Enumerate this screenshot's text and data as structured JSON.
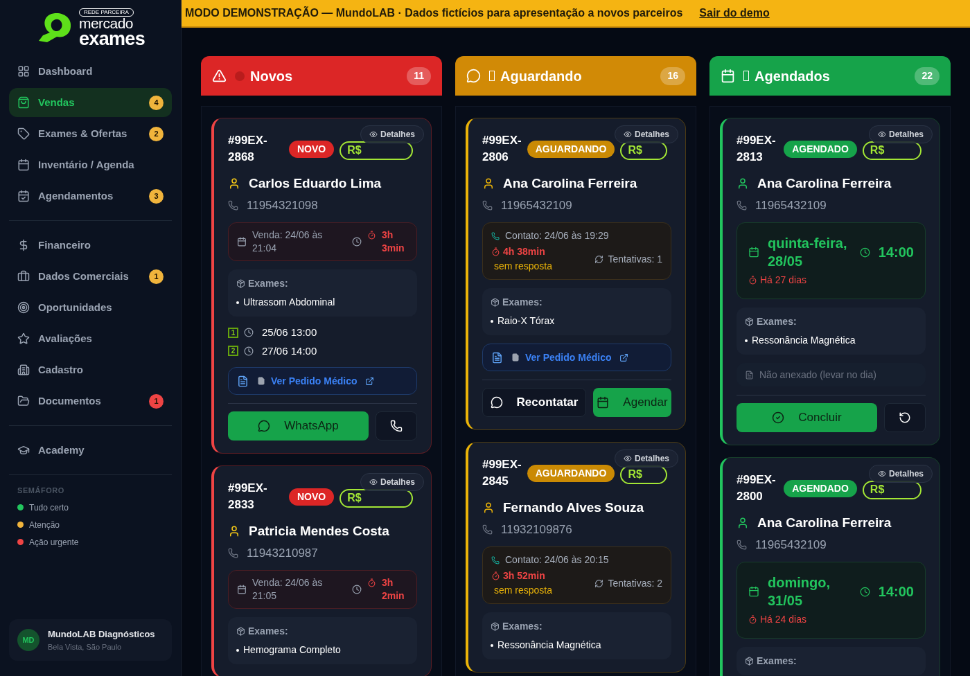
{
  "brand": {
    "tag": "REDE PARCEIRA",
    "line1": "mercado",
    "line2": "exames"
  },
  "nav": [
    [
      {
        "kind": "grid",
        "label": "Dashboard",
        "selected": false
      },
      {
        "kind": "bag",
        "label": "Vendas",
        "selected": true,
        "badge": "4",
        "color": "#f0b43c"
      },
      {
        "kind": "tag",
        "label": "Exames & Ofertas",
        "selected": false,
        "badge": "2",
        "color": "#f0b43c"
      },
      {
        "kind": "calendar",
        "label": "Inventário / Agenda",
        "selected": false
      },
      {
        "kind": "appointments",
        "label": "Agendamentos",
        "selected": false,
        "badge": "3",
        "color": "#f0b43c"
      }
    ],
    [
      {
        "kind": "finance",
        "label": "Financeiro",
        "selected": false
      },
      {
        "kind": "business",
        "label": "Dados Comerciais",
        "selected": false,
        "badge": "1",
        "color": "#f0b43c"
      },
      {
        "kind": "target",
        "label": "Oportunidades",
        "selected": false
      },
      {
        "kind": "star",
        "label": "Avaliações",
        "selected": false
      },
      {
        "kind": "building",
        "label": "Cadastro",
        "selected": false
      },
      {
        "kind": "folder",
        "label": "Documentos",
        "selected": false,
        "badge": "1",
        "color": "#ef4444"
      }
    ],
    [
      {
        "kind": "academy",
        "label": "Academy",
        "selected": false
      }
    ]
  ],
  "legend": {
    "title": "SEMÁFORO",
    "items": [
      {
        "label": "Tudo certo",
        "color": "#22c55e"
      },
      {
        "label": "Atenção",
        "color": "#f0b43c"
      },
      {
        "label": "Ação urgente",
        "color": "#ef4444"
      }
    ]
  },
  "account": {
    "initials": "MD",
    "name": "MundoLAB Diagnósticos",
    "location": "Bela Vista, São Paulo"
  },
  "banner": {
    "text": "MODO DEMONSTRAÇÃO — MundoLAB · Dados fictícios para apresentação a novos parceiros",
    "link": "Sair do demo"
  },
  "columns": [
    {
      "kind": "new",
      "title": "Novos",
      "count": "11",
      "cards": [
        {
          "id": "#99EX-2868",
          "status": "NOVO",
          "price": "R$",
          "details": "Detalhes",
          "name": "Carlos Eduardo Lima",
          "phone": "11954321098",
          "timing": {
            "kind": "sale",
            "date": "Venda: 24/06 às 21:04",
            "elapsed": "3h 3min"
          },
          "exams": {
            "label": "Exames:",
            "items": [
              "Ultrassom Abdominal"
            ]
          },
          "slots": [
            {
              "number": "1",
              "time": "25/06 13:00"
            },
            {
              "number": "2",
              "time": "27/06 14:00"
            }
          ],
          "order": {
            "kind": "link",
            "label": "Ver Pedido Médico"
          },
          "actions": [
            {
              "kind": "whatsapp",
              "label": "WhatsApp"
            },
            {
              "kind": "call"
            }
          ]
        },
        {
          "id": "#99EX-2833",
          "status": "NOVO",
          "price": "R$",
          "details": "Detalhes",
          "name": "Patricia Mendes Costa",
          "phone": "11943210987",
          "timing": {
            "kind": "sale",
            "date": "Venda: 24/06 às 21:05",
            "elapsed": "3h 2min"
          },
          "exams": {
            "label": "Exames:",
            "items": [
              "Hemograma Completo"
            ]
          }
        }
      ]
    },
    {
      "kind": "waiting",
      "title": "Aguardando",
      "count": "16",
      "cards": [
        {
          "id": "#99EX-2806",
          "status": "AGUARDANDO",
          "price": "R$",
          "details": "Detalhes",
          "name": "Ana Carolina Ferreira",
          "phone": "11965432109",
          "timing": {
            "kind": "contact",
            "date": "Contato: 24/06 às 19:29",
            "elapsed": "4h 38min",
            "note": "sem resposta",
            "attempts": "Tentativas: 1"
          },
          "exams": {
            "label": "Exames:",
            "items": [
              "Raio-X Tórax"
            ]
          },
          "order": {
            "kind": "link",
            "label": "Ver Pedido Médico"
          },
          "actions": [
            {
              "kind": "recontact",
              "label": "Recontatar"
            },
            {
              "kind": "schedule",
              "label": "Agendar"
            }
          ]
        },
        {
          "id": "#99EX-2845",
          "status": "AGUARDANDO",
          "price": "R$",
          "details": "Detalhes",
          "name": "Fernando Alves Souza",
          "phone": "11932109876",
          "timing": {
            "kind": "contact",
            "date": "Contato: 24/06 às 20:15",
            "elapsed": "3h 52min",
            "note": "sem resposta",
            "attempts": "Tentativas: 2"
          },
          "exams": {
            "label": "Exames:",
            "items": [
              "Ressonância Magnética"
            ]
          }
        }
      ]
    },
    {
      "kind": "scheduled",
      "title": "Agendados",
      "count": "22",
      "cards": [
        {
          "id": "#99EX-2813",
          "status": "AGENDADO",
          "price": "R$",
          "details": "Detalhes",
          "name": "Ana Carolina Ferreira",
          "phone": "11965432109",
          "timing": {
            "kind": "schedule",
            "date": "quinta-feira, 28/05",
            "time": "14:00",
            "ago": "Há 27 dias"
          },
          "exams": {
            "label": "Exames:",
            "items": [
              "Ressonância Magnética"
            ]
          },
          "order": {
            "kind": "missing",
            "label": "Não anexado (levar no dia)"
          },
          "actions": [
            {
              "kind": "complete",
              "label": "Concluir"
            },
            {
              "kind": "undo"
            }
          ]
        },
        {
          "id": "#99EX-2800",
          "status": "AGENDADO",
          "price": "R$",
          "details": "Detalhes",
          "name": "Ana Carolina Ferreira",
          "phone": "11965432109",
          "timing": {
            "kind": "schedule",
            "date": "domingo, 31/05",
            "time": "14:00",
            "ago": "Há 24 dias"
          },
          "exams": {
            "label": "Exames:"
          }
        }
      ]
    }
  ]
}
